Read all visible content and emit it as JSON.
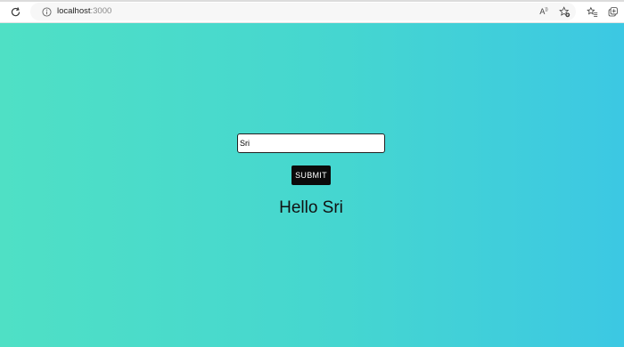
{
  "browser": {
    "url_host": "localhost",
    "url_port": ":3000",
    "icons": [
      "reload-icon",
      "info-icon",
      "read-aloud-icon",
      "add-favorite-icon",
      "favorites-icon",
      "collections-icon"
    ],
    "read_aloud_label": "A",
    "read_aloud_super": "))"
  },
  "form": {
    "input_value": "Sri",
    "submit_label": "SUBMIT"
  },
  "greeting": {
    "text": "Hello Sri"
  },
  "colors": {
    "gradient_start": "#4fe0c5",
    "gradient_end": "#3cc8e3",
    "button_bg": "#0b0b0b"
  }
}
